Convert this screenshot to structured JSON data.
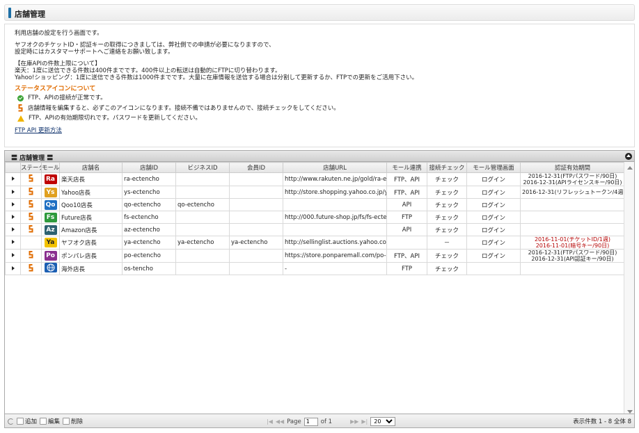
{
  "page_title": "店舗管理",
  "info": {
    "intro": "利用店舗の設定を行う画面です。",
    "yahoo_line1": "ヤフオクのチケットID・認証キーの取得につきましては、弊社側での申請が必要になりますので、",
    "yahoo_line2": "設定時にはカスタマーサポートへご連絡をお願い致します。",
    "api_heading": "【在庫APIの件数上限について】",
    "api_line1": "楽天：1度に送信できる件数は400件までです。400件以上の転送は自動的にFTPに切り替わります。",
    "api_line2": "Yahoo!ショッピング：1度に送信できる件数は1000件までです。大量に在庫情報を送信する場合は分割して更新するか、FTPでの更新をご活用下さい。",
    "status_title": "ステータスアイコンについて",
    "status_ok": "FTP、APIの接続が正常です。",
    "status_edit": "店舗情報を編集すると、必ずこのアイコンになります。接続不備ではありませんので、接続チェックをしてください。",
    "status_warn": "FTP、APIの有効期限切れです。パスワードを更新してください。",
    "link": "FTP API 更新方法"
  },
  "grid": {
    "caption": "店舗管理",
    "columns": [
      "ステータス",
      "モール",
      "店舗名",
      "店舗ID",
      "ビジネスID",
      "会員ID",
      "店舗URL",
      "モール連携",
      "接続チェック",
      "モール管理画面",
      "認証有効期間"
    ],
    "rows": [
      {
        "status": "edit",
        "logo": "Ra",
        "logo_color": "#bf0000",
        "name": "楽天店長",
        "store_id": "ra-ectencho",
        "biz_id": "",
        "member_id": "",
        "url": "http://www.rakuten.ne.jp/gold/ra-ectencho",
        "link": "FTP、API",
        "check": "チェック",
        "admin": "ログイン",
        "auth1": "2016-12-31(FTPパスワード/90日)",
        "auth2": "2016-12-31(APIライセンスキー/90日)",
        "red": false
      },
      {
        "status": "edit",
        "logo": "Ys",
        "logo_color": "#e0a020",
        "name": "Yahoo店長",
        "store_id": "ys-ectencho",
        "biz_id": "",
        "member_id": "",
        "url": "http://store.shopping.yahoo.co.jp/ys-ectencho",
        "link": "FTP、API",
        "check": "チェック",
        "admin": "ログイン",
        "auth1": "2016-12-31(リフレッシュトークン/4週)",
        "auth2": "",
        "red": false
      },
      {
        "status": "edit",
        "logo": "Qo",
        "logo_color": "#1f6fc2",
        "name": "Qoo10店長",
        "store_id": "qo-ectencho",
        "biz_id": "qo-ectencho",
        "member_id": "",
        "url": "",
        "link": "API",
        "check": "チェック",
        "admin": "ログイン",
        "auth1": "",
        "auth2": "",
        "red": false
      },
      {
        "status": "edit",
        "logo": "Fs",
        "logo_color": "#2e9a3c",
        "name": "Future店長",
        "store_id": "fs-ectencho",
        "biz_id": "",
        "member_id": "",
        "url": "http://000.future-shop.jp/fs/fs-ectencho",
        "link": "FTP",
        "check": "チェック",
        "admin": "ログイン",
        "auth1": "",
        "auth2": "",
        "red": false
      },
      {
        "status": "edit",
        "logo": "Az",
        "logo_color": "#2d6170",
        "name": "Amazon店長",
        "store_id": "az-ectencho",
        "biz_id": "",
        "member_id": "",
        "url": "",
        "link": "API",
        "check": "チェック",
        "admin": "ログイン",
        "auth1": "",
        "auth2": "",
        "red": false
      },
      {
        "status": "",
        "logo": "Ya",
        "logo_color": "#f2c200",
        "name": "ヤフオク店長",
        "store_id": "ya-ectencho",
        "biz_id": "ya-ectencho",
        "member_id": "ya-ectencho",
        "url": "http://sellinglist.auctions.yahoo.co.jp/user/ya-ectencho",
        "link": "",
        "check": "－",
        "admin": "ログイン",
        "auth1": "2016-11-01(チケットID/1週)",
        "auth2": "2016-11-01(暗号キー/90日)",
        "red": true
      },
      {
        "status": "edit",
        "logo": "Po",
        "logo_color": "#8a2f8f",
        "name": "ポンパレ店長",
        "store_id": "po-ectencho",
        "biz_id": "",
        "member_id": "",
        "url": "https://store.ponparemall.com/po-ectencho",
        "link": "FTP、API",
        "check": "チェック",
        "admin": "ログイン",
        "auth1": "2016-12-31(FTPパスワード/90日)",
        "auth2": "2016-12-31(API認証キー/90日)",
        "red": false
      },
      {
        "status": "edit",
        "logo": "globe",
        "logo_color": "#1c5fb3",
        "name": "海外店長",
        "store_id": "os-tencho",
        "biz_id": "",
        "member_id": "",
        "url": "-",
        "link": "FTP",
        "check": "チェック",
        "admin": "",
        "auth1": "",
        "auth2": "",
        "red": false
      }
    ]
  },
  "pager": {
    "add": "追加",
    "edit": "編集",
    "delete": "削除",
    "page_label": "Page",
    "page_value": "1",
    "of_label": "of 1",
    "rows_per_page": "20",
    "summary": "表示件数 1 - 8 全体 8"
  }
}
